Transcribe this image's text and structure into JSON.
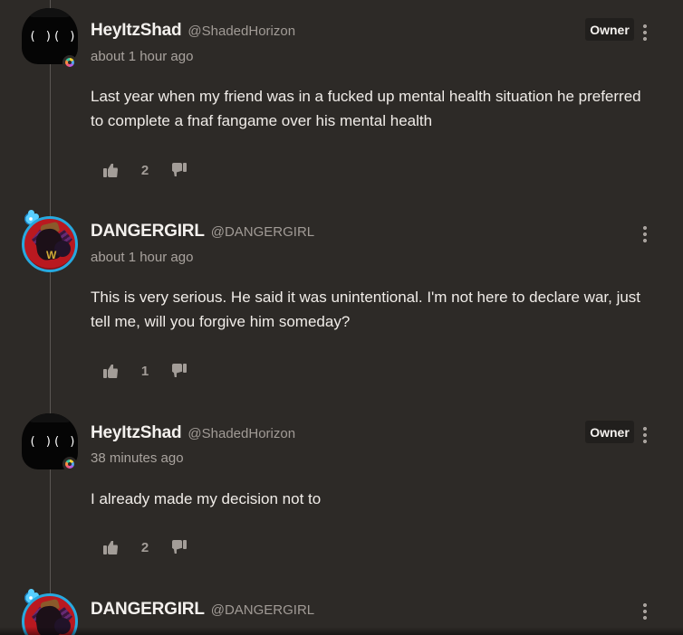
{
  "comments": [
    {
      "author": "HeyItzShad",
      "handle": "@ShadedHorizon",
      "badge": "Owner",
      "time": "about 1 hour ago",
      "body": "Last year when my friend was in a fucked up mental health situation he preferred to complete a fnaf fangame over his mental health",
      "likes": "2",
      "avatar": "dark-avatar-icon"
    },
    {
      "author": "DANGERGIRL",
      "handle": "@DANGERGIRL",
      "time": "about 1 hour ago",
      "body": "This is very serious. He said it was unintentional. I'm not here to declare war, just tell me, will you forgive him someday?",
      "likes": "1",
      "avatar": "red-avatar-icon"
    },
    {
      "author": "HeyItzShad",
      "handle": "@ShadedHorizon",
      "badge": "Owner",
      "time": "38 minutes ago",
      "body": "I already made my decision not to",
      "likes": "2",
      "avatar": "dark-avatar-icon"
    },
    {
      "author": "DANGERGIRL",
      "handle": "@DANGERGIRL",
      "avatar": "red-avatar-icon"
    }
  ],
  "colors": {
    "background": "#2d2a27",
    "text": "#f0ece8",
    "muted": "#a39d98",
    "owner_badge": "#211f1d",
    "avatar_ring": "#27a9df"
  },
  "icons": {
    "like": "thumbs-up-icon",
    "dislike": "thumbs-down-icon",
    "more": "more-vertical-icon",
    "status": "rainbow-status-icon"
  }
}
